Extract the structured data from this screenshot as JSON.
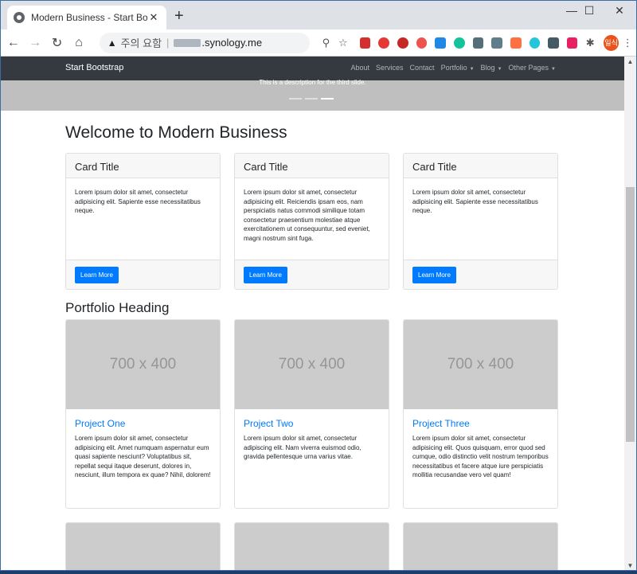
{
  "browser": {
    "tab_title": "Modern Business - Start Bootstrap",
    "new_tab": "+",
    "minimize": "—",
    "maximize": "☐",
    "close": "✕",
    "address_warning": "주의 요함",
    "address_domain": ".synology.me",
    "profile_label": "일식"
  },
  "navbar": {
    "brand": "Start Bootstrap",
    "links": [
      {
        "label": "About",
        "dropdown": false
      },
      {
        "label": "Services",
        "dropdown": false
      },
      {
        "label": "Contact",
        "dropdown": false
      },
      {
        "label": "Portfolio",
        "dropdown": true
      },
      {
        "label": "Blog",
        "dropdown": true
      },
      {
        "label": "Other Pages",
        "dropdown": true
      }
    ]
  },
  "carousel": {
    "caption": "This is a description for the third slide."
  },
  "welcome": {
    "heading": "Welcome to Modern Business",
    "cards": [
      {
        "title": "Card Title",
        "text": "Lorem ipsum dolor sit amet, consectetur adipisicing elit. Sapiente esse necessitatibus neque.",
        "button": "Learn More"
      },
      {
        "title": "Card Title",
        "text": "Lorem ipsum dolor sit amet, consectetur adipisicing elit. Reiciendis ipsam eos, nam perspiciatis natus commodi similique totam consectetur praesentium molestiae atque exercitationem ut consequuntur, sed eveniet, magni nostrum sint fuga.",
        "button": "Learn More"
      },
      {
        "title": "Card Title",
        "text": "Lorem ipsum dolor sit amet, consectetur adipisicing elit. Sapiente esse necessitatibus neque.",
        "button": "Learn More"
      }
    ]
  },
  "portfolio": {
    "heading": "Portfolio Heading",
    "placeholder": "700 x 400",
    "projects": [
      {
        "title": "Project One",
        "text": "Lorem ipsum dolor sit amet, consectetur adipisicing elit. Amet numquam aspernatur eum quasi sapiente nesciunt? Voluptatibus sit, repellat sequi itaque deserunt, dolores in, nesciunt, illum tempora ex quae? Nihil, dolorem!"
      },
      {
        "title": "Project Two",
        "text": "Lorem ipsum dolor sit amet, consectetur adipiscing elit. Nam viverra euismod odio, gravida pellentesque urna varius vitae."
      },
      {
        "title": "Project Three",
        "text": "Lorem ipsum dolor sit amet, consectetur adipisicing elit. Quos quisquam, error quod sed cumque, odio distinctio velit nostrum temporibus necessitatibus et facere atque iure perspiciatis mollitia recusandae vero vel quam!"
      }
    ]
  }
}
